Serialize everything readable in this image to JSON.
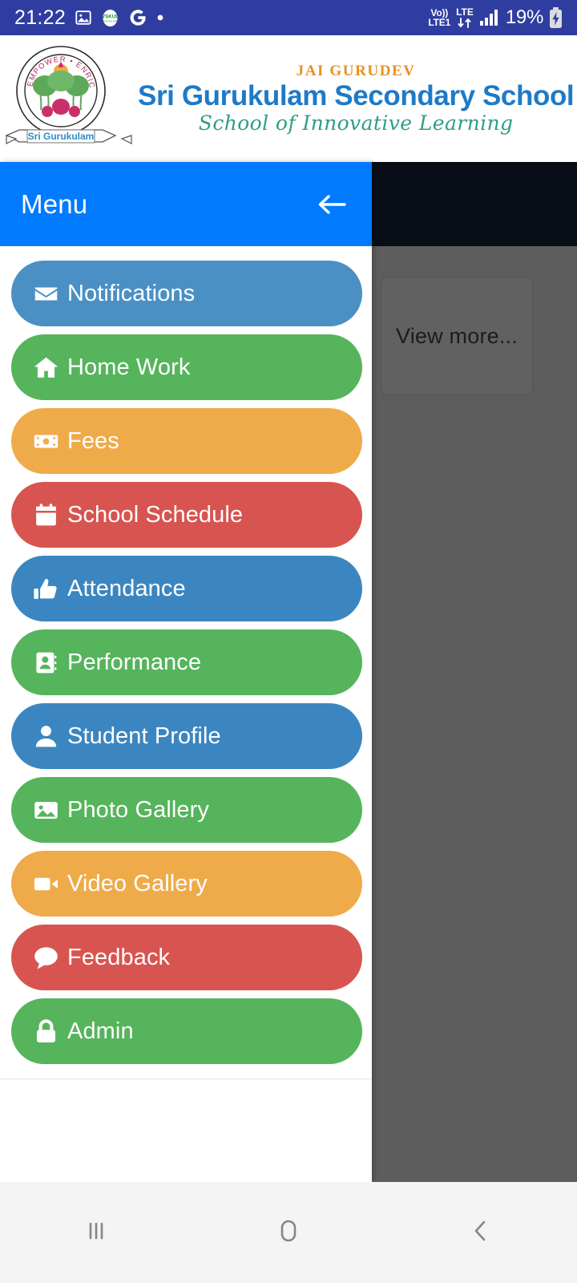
{
  "status_bar": {
    "clock": "21:22",
    "battery_percent": "19%",
    "volte_top": "Vo))",
    "volte_bottom": "LTE1",
    "lte_top": "LTE",
    "icons": [
      "image-icon",
      "vskul-app-icon",
      "google-icon",
      "dot-icon",
      "volte-icon",
      "lte-data-icon",
      "signal-bars-icon",
      "battery-charging-icon"
    ],
    "background_color": "#2f3da0"
  },
  "app_header": {
    "jai_gurudev": "JAI GURUDEV",
    "school_name": "Sri Gurukulam Secondary School",
    "tagline": "School of Innovative Learning",
    "logo_ribbon_text": "Sri Gurukulam",
    "logo_motto_text": "EMPOWER • ENRICH • ENLIGHTEN"
  },
  "background_content": {
    "view_more_label": "View more...",
    "topbar_color": "#17233f",
    "scrim_opacity": "0.62"
  },
  "drawer": {
    "title": "Menu",
    "back_icon": "arrow-left-icon",
    "header_color": "#007bff",
    "items": [
      {
        "label": "Notifications",
        "icon": "envelope-icon",
        "color": "#4a90c4"
      },
      {
        "label": "Home Work",
        "icon": "home-icon",
        "color": "#56b45c"
      },
      {
        "label": "Fees",
        "icon": "money-bill-icon",
        "color": "#efab4a"
      },
      {
        "label": "School Schedule",
        "icon": "calendar-icon",
        "color": "#d85450"
      },
      {
        "label": "Attendance",
        "icon": "thumbs-up-icon",
        "color": "#3b86c0"
      },
      {
        "label": "Performance",
        "icon": "address-card-icon",
        "color": "#56b45c"
      },
      {
        "label": "Student Profile",
        "icon": "user-icon",
        "color": "#3b86c0"
      },
      {
        "label": "Photo Gallery",
        "icon": "image-icon",
        "color": "#56b45c"
      },
      {
        "label": "Video Gallery",
        "icon": "video-camera-icon",
        "color": "#efab4a"
      },
      {
        "label": "Feedback",
        "icon": "comment-icon",
        "color": "#d85450"
      },
      {
        "label": "Admin",
        "icon": "lock-icon",
        "color": "#56b45c"
      }
    ]
  },
  "nav_bar": {
    "buttons": [
      {
        "name": "recents",
        "icon": "recents-icon"
      },
      {
        "name": "home",
        "icon": "home-circle-icon"
      },
      {
        "name": "back",
        "icon": "chevron-left-icon"
      }
    ]
  }
}
